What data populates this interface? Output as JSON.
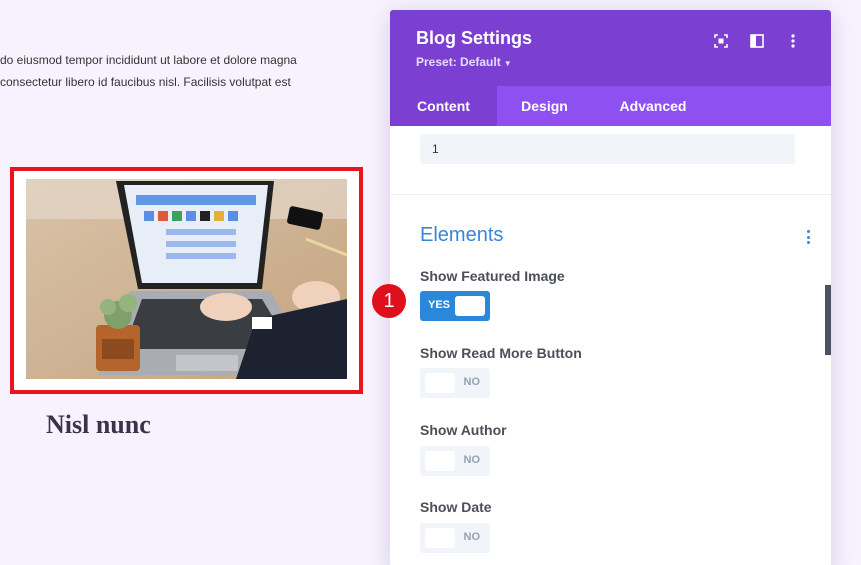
{
  "background": {
    "text_lines": [
      "do eiusmod tempor incididunt ut labore et dolore magna",
      "consectetur libero id faucibus nisl. Facilisis volutpat est"
    ],
    "post_title": "Nisl nunc"
  },
  "panel": {
    "title": "Blog Settings",
    "preset": "Preset: Default",
    "icons": [
      "focus-icon",
      "split-view-icon",
      "more-vertical-icon"
    ],
    "tabs": [
      {
        "label": "Content",
        "active": true
      },
      {
        "label": "Design",
        "active": false
      },
      {
        "label": "Advanced",
        "active": false
      }
    ],
    "number_input_value": "1",
    "section_title": "Elements",
    "options": [
      {
        "label": "Show Featured Image",
        "state": "YES"
      },
      {
        "label": "Show Read More Button",
        "state": "NO"
      },
      {
        "label": "Show Author",
        "state": "NO"
      },
      {
        "label": "Show Date",
        "state": "NO"
      }
    ]
  },
  "annotation": {
    "badge": "1"
  },
  "colors": {
    "header": "#7b40d2",
    "tabs": "#8f50f2",
    "accent": "#2b87da",
    "highlight": "#e9141c"
  }
}
